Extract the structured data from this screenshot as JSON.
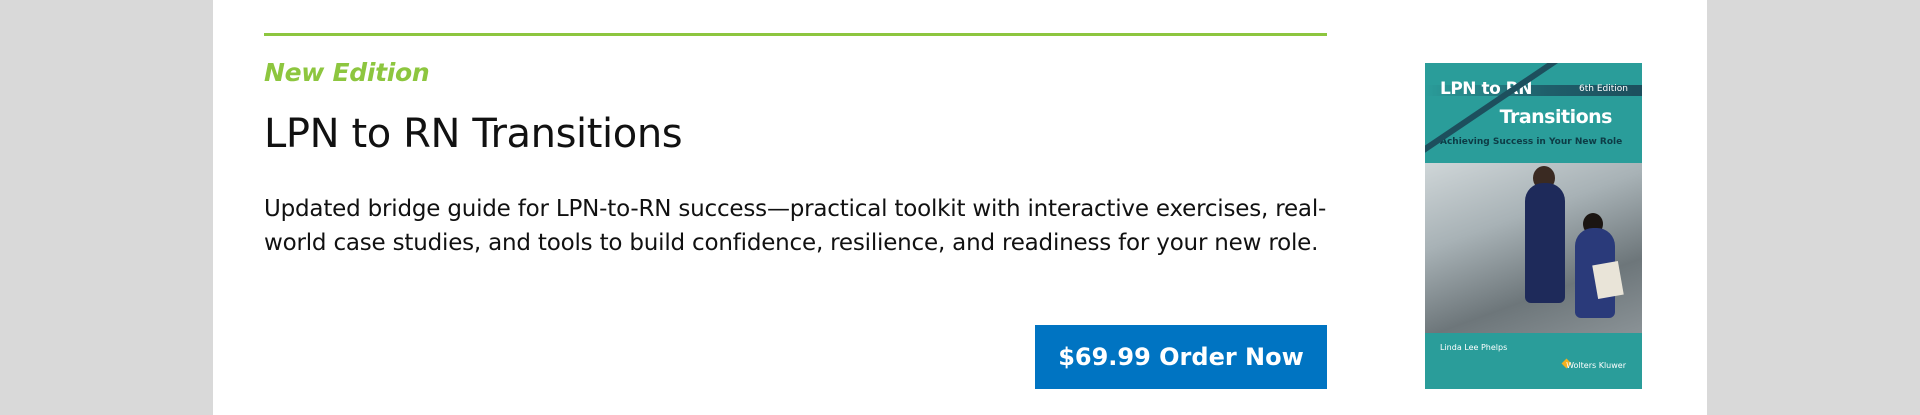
{
  "promo": {
    "badge": "New Edition",
    "title": "LPN to RN Transitions",
    "description": "Updated bridge guide for LPN-to-RN success—practical toolkit with interactive exercises, real-world case studies, and tools to build confidence, resilience, and readiness for your new role.",
    "order_button": "$69.99 Order Now"
  },
  "cover": {
    "title_line1": "LPN to RN",
    "title_line2": "Transitions",
    "edition": "6th Edition",
    "subtitle": "Achieving Success in Your New Role",
    "author": "Linda Lee Phelps",
    "publisher": "Wolters Kluwer"
  },
  "colors": {
    "accent_green": "#8dc63f",
    "button_blue": "#0074c2",
    "cover_teal": "#2a9d9a",
    "page_gray": "#d9d9d9"
  },
  "icons": [
    "wolters-kluwer-logo-icon"
  ]
}
